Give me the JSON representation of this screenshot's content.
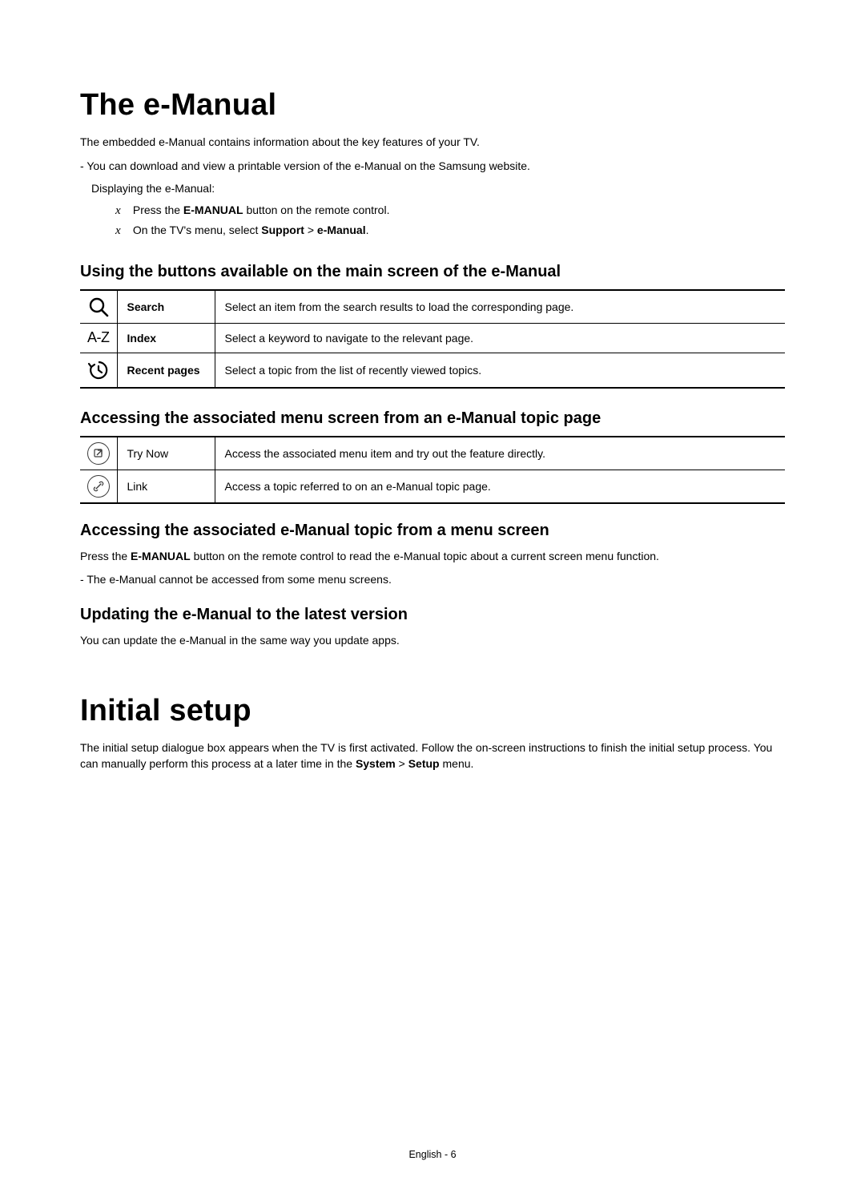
{
  "section1": {
    "title": "The e-Manual",
    "intro": "The embedded e-Manual contains information about the key features of your TV.",
    "dash1": "You can download and view a printable version of the e-Manual on the Samsung website.",
    "displaying": "Displaying the e-Manual:",
    "x1_pre": "Press the ",
    "x1_bold": "E-MANUAL",
    "x1_post": " button on the remote control.",
    "x2_pre": "On the TV's menu, select ",
    "x2_b1": "Support",
    "x2_sep": " > ",
    "x2_b2": "e-Manual",
    "x2_post": "."
  },
  "sub1": {
    "heading": "Using the buttons available on the main screen of the e-Manual",
    "rows": [
      {
        "label": "Search",
        "desc": "Select an item from the search results to load the corresponding page."
      },
      {
        "label": "Index",
        "desc": "Select a keyword to navigate to the relevant page."
      },
      {
        "label": "Recent pages",
        "desc": "Select a topic from the list of recently viewed topics."
      }
    ]
  },
  "sub2": {
    "heading": "Accessing the associated menu screen from an e-Manual topic page",
    "rows": [
      {
        "label": "Try Now",
        "desc": "Access the associated menu item and try out the feature directly."
      },
      {
        "label": "Link",
        "desc": "Access a topic referred to on an e-Manual topic page."
      }
    ]
  },
  "sub3": {
    "heading": "Accessing the associated e-Manual topic from a menu screen",
    "p_pre": "Press the ",
    "p_bold": "E-MANUAL",
    "p_post": " button on the remote control to read the e-Manual topic about a current screen menu function.",
    "dash": "The e-Manual cannot be accessed from some menu screens."
  },
  "sub4": {
    "heading": "Updating the e-Manual to the latest version",
    "p": "You can update the e-Manual in the same way you update apps."
  },
  "section2": {
    "title": "Initial setup",
    "p_pre": "The initial setup dialogue box appears when the TV is first activated. Follow the on-screen instructions to finish the initial setup process. You can manually perform this process at a later time in the ",
    "b1": "System",
    "sep": " > ",
    "b2": "Setup",
    "p_post": " menu."
  },
  "footer": "English - 6",
  "icons": {
    "az": "A-Z"
  }
}
